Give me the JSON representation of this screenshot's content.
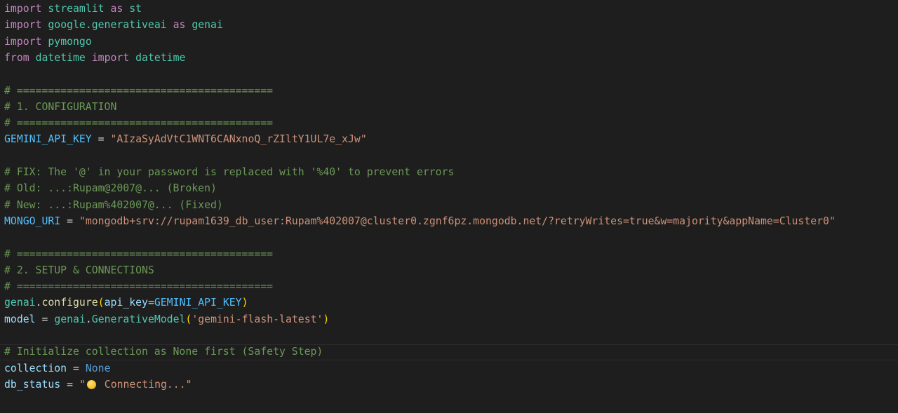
{
  "lines": {
    "l1": [
      "import",
      "streamlit",
      "as",
      "st"
    ],
    "l2": [
      "import",
      "google.generativeai",
      "as",
      "genai"
    ],
    "l3": [
      "import",
      "pymongo"
    ],
    "l4": [
      "from",
      "datetime",
      "import",
      "datetime"
    ],
    "l6": "# =========================================",
    "l7": "# 1. CONFIGURATION",
    "l8": "# =========================================",
    "l9": {
      "name": "GEMINI_API_KEY",
      "op": "=",
      "value": "\"AIzaSyAdVtC1WNT6CANxnoQ_rZIltY1UL7e_xJw\""
    },
    "l11": "# FIX: The '@' in your password is replaced with '%40' to prevent errors",
    "l12": "# Old: ...:Rupam@2007@... (Broken)",
    "l13": "# New: ...:Rupam%402007@... (Fixed)",
    "l14": {
      "name": "MONGO_URI",
      "op": "=",
      "value": "\"mongodb+srv://rupam1639_db_user:Rupam%402007@cluster0.zgnf6pz.mongodb.net/?retryWrites=true&w=majority&appName=Cluster0\""
    },
    "l16": "# =========================================",
    "l17": "# 2. SETUP & CONNECTIONS",
    "l18": "# =========================================",
    "l19": {
      "obj": "genai",
      "dot": ".",
      "fn": "configure",
      "open": "(",
      "param": "api_key",
      "eq": "=",
      "arg": "GEMINI_API_KEY",
      "close": ")"
    },
    "l20": {
      "name": "model",
      "op": "=",
      "obj": "genai",
      "dot": ".",
      "cls": "GenerativeModel",
      "open": "(",
      "arg": "'gemini-flash-latest'",
      "close": ")"
    },
    "l22": "# Initialize collection as None first (Safety Step)",
    "l23": {
      "name": "collection",
      "op": "=",
      "value": "None"
    },
    "l24": {
      "name": "db_status",
      "op": "=",
      "quote_open": "\"",
      "text": "Connecting...\""
    }
  },
  "icons": {
    "status_emoji": "yellow-circle-emoji"
  },
  "colors": {
    "background": "#1e1e1e",
    "keyword": "#c586c0",
    "module": "#4ec9b0",
    "variable": "#9cdcfe",
    "constant": "#4fc1ff",
    "string": "#ce9178",
    "comment": "#6a9955",
    "function": "#dcdcaa",
    "bool": "#569cd6"
  }
}
